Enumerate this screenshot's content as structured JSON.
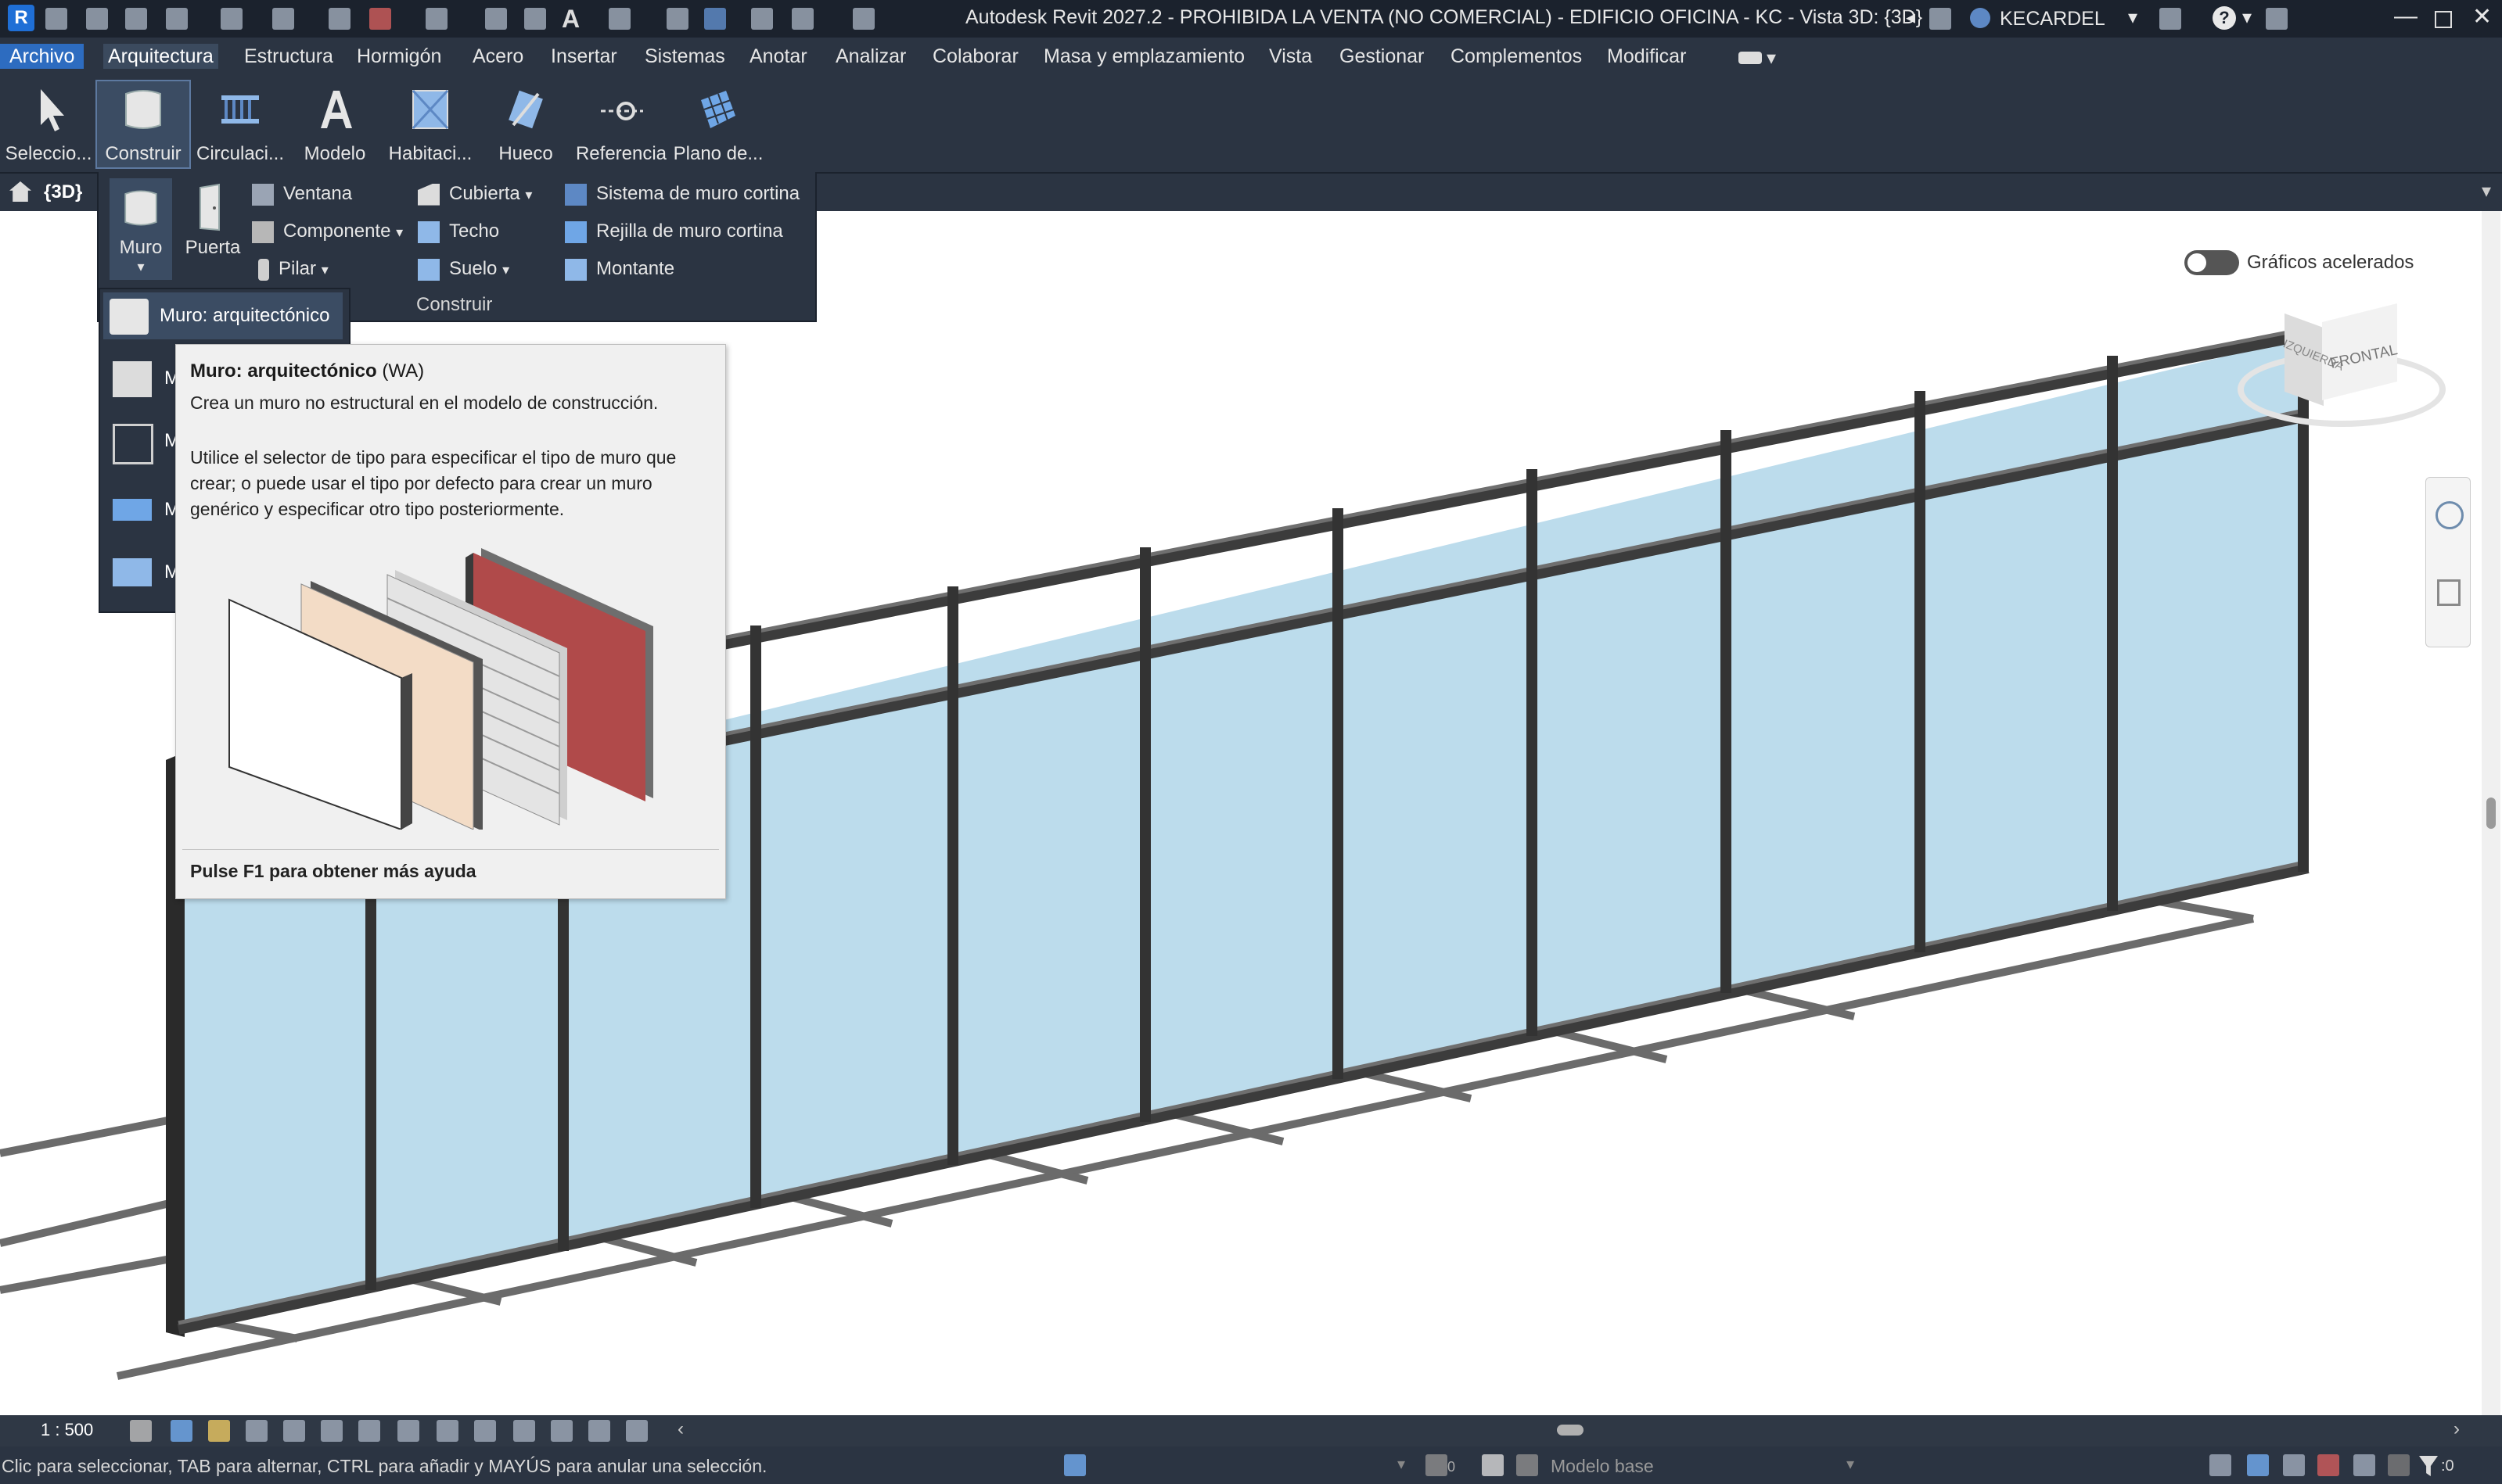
{
  "app": {
    "title": "Autodesk Revit 2027.2 - PROHIBIDA LA VENTA (NO COMERCIAL) - EDIFICIO OFICINA - KC - Vista 3D: {3D}",
    "user": "KECARDEL"
  },
  "menu": {
    "items": [
      "Archivo",
      "Arquitectura",
      "Estructura",
      "Hormigón",
      "Acero",
      "Insertar",
      "Sistemas",
      "Anotar",
      "Analizar",
      "Colaborar",
      "Masa y emplazamiento",
      "Vista",
      "Gestionar",
      "Complementos",
      "Modificar"
    ],
    "active": "Arquitectura"
  },
  "ribbon": {
    "buttons": [
      "Seleccio...",
      "Construir",
      "Circulaci...",
      "Modelo",
      "Habitaci...",
      "Hueco",
      "Referencia",
      "Plano de..."
    ]
  },
  "view_tab": "{3D}",
  "construir_panel": {
    "big": [
      "Muro",
      "Puerta"
    ],
    "col1": [
      "Ventana",
      "Componente",
      "Pilar"
    ],
    "col2": [
      "Cubierta",
      "Techo",
      "Suelo"
    ],
    "col3": [
      "Sistema de muro cortina",
      "Rejilla de muro cortina",
      "Montante"
    ],
    "footer": "Construir"
  },
  "muro_flyout": {
    "first": "Muro: arquitectónico",
    "truncated": [
      "M",
      "M",
      "M",
      "M"
    ]
  },
  "tooltip": {
    "title": "Muro: arquitectónico",
    "shortcut": "(WA)",
    "line1": "Crea un muro no estructural en el modelo de construcción.",
    "line2": "Utilice el selector de tipo para especificar el tipo de muro que crear; o puede usar el tipo por defecto para crear un muro genérico y especificar otro tipo posteriormente.",
    "footer": "Pulse F1 para obtener más ayuda"
  },
  "canvas": {
    "accel_graphics": "Gráficos acelerados",
    "viewcube_left": "IZQUIERDA",
    "viewcube_front": "FRONTAL"
  },
  "viewbar": {
    "scale": "1 : 500"
  },
  "status": {
    "hint": "Clic para seleccionar, TAB para alternar, CTRL para añadir y MAYÚS para anular una selección.",
    "model": "Modelo base",
    "selection_count": ":0",
    "worksets": "0"
  },
  "colors": {
    "glass": "#bcdcec",
    "mullion": "#3a3a3a",
    "ui_dark": "#2b3442",
    "file_tab": "#2d6cc0"
  }
}
